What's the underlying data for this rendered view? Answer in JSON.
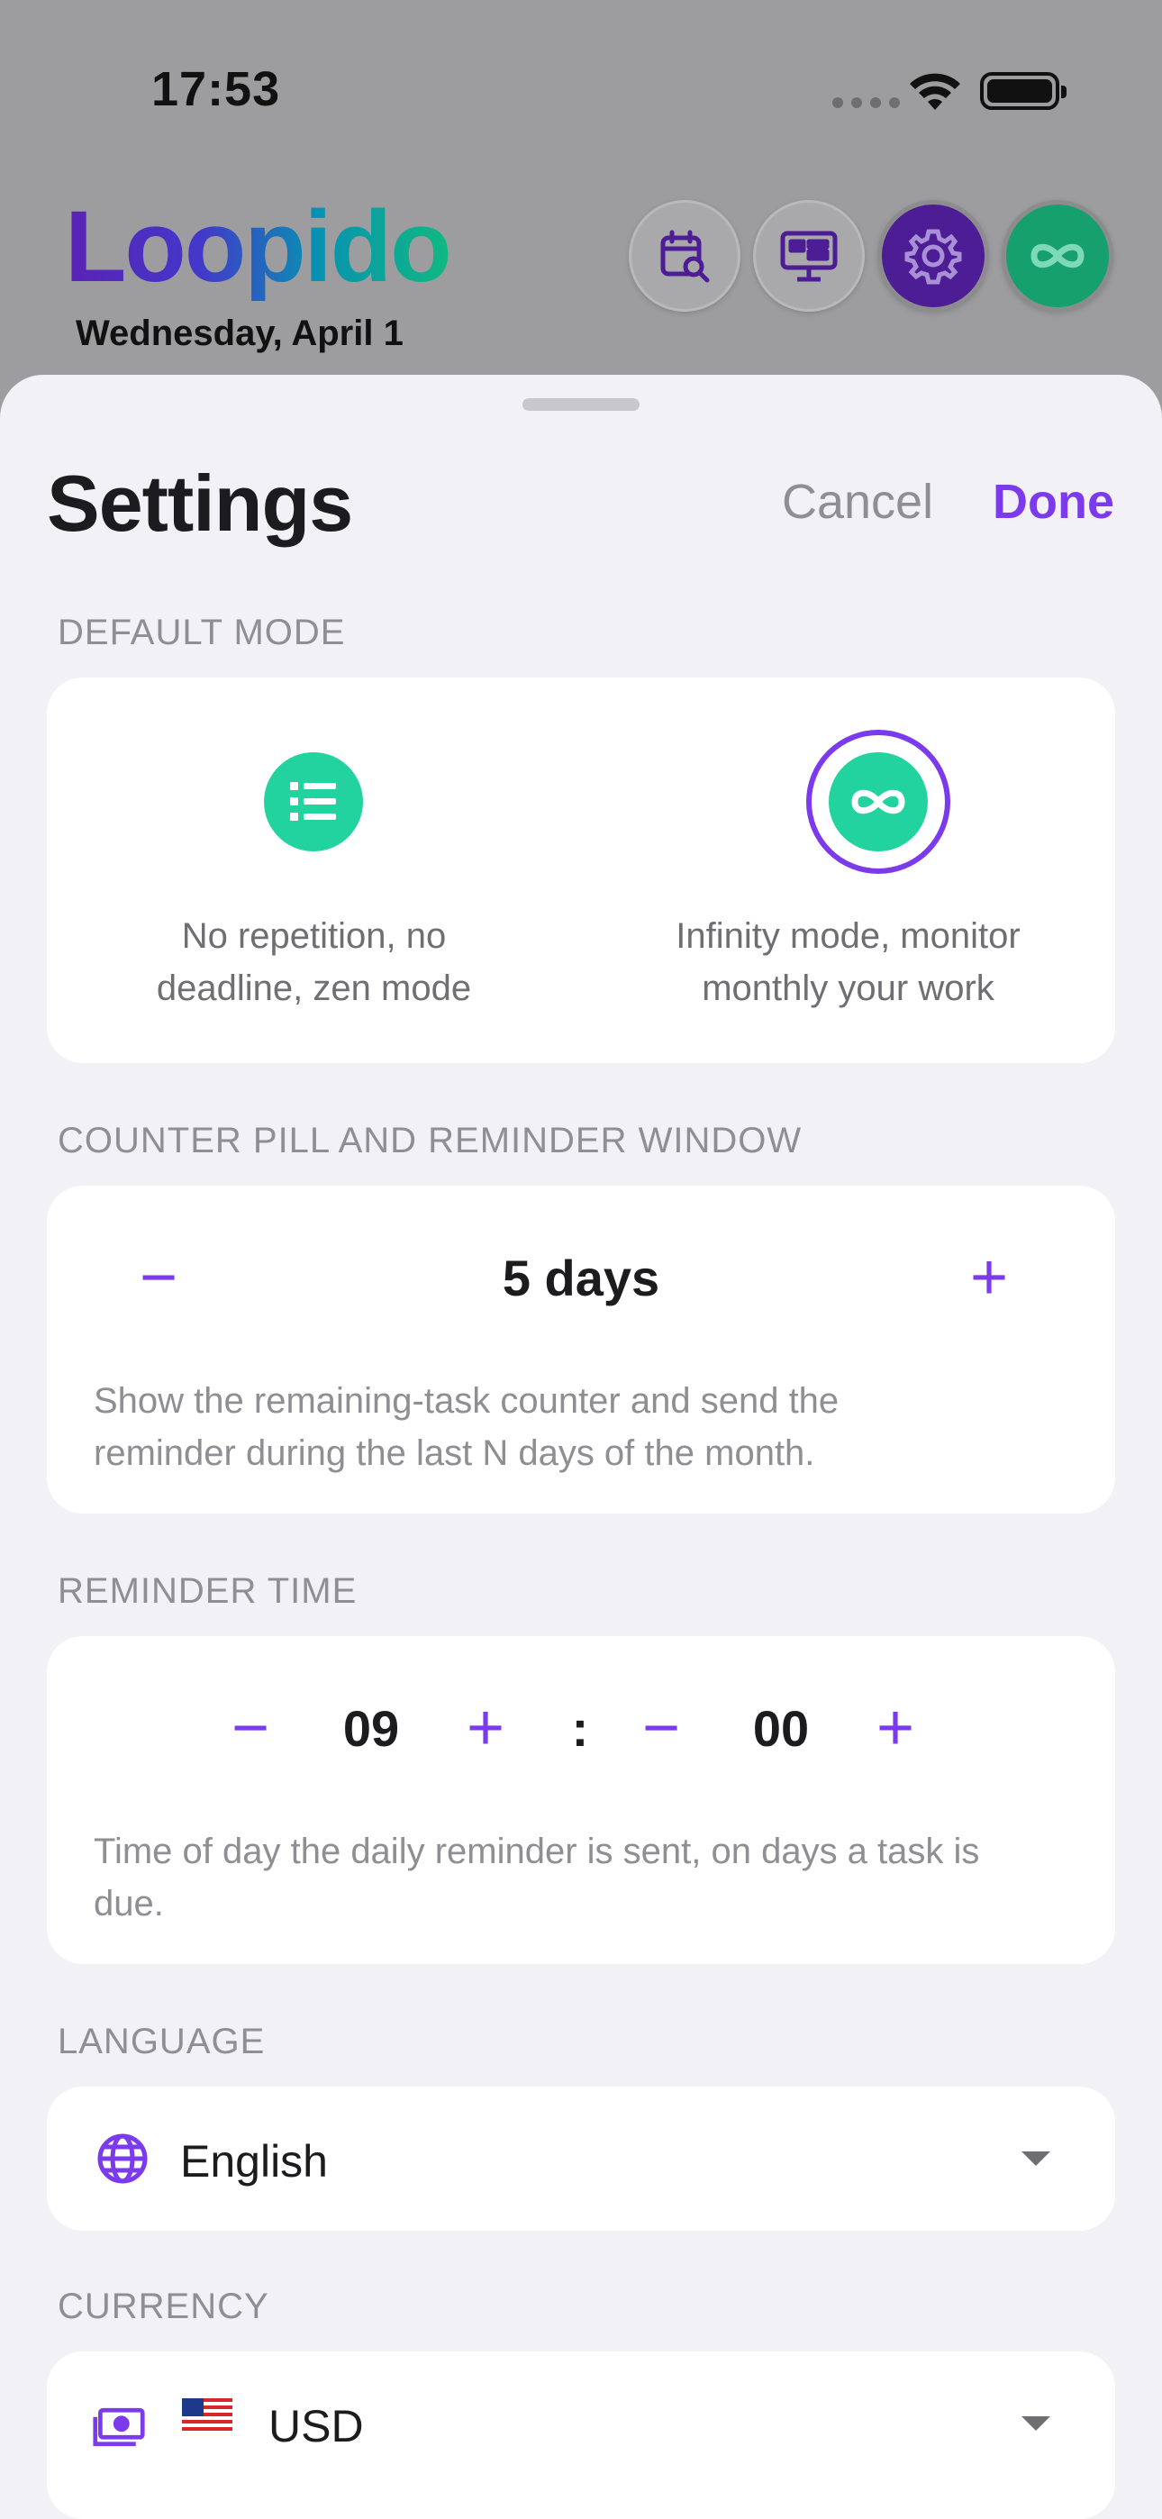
{
  "status_bar": {
    "time": "17:53"
  },
  "app": {
    "logo_text": "Loopido",
    "date": "Wednesday, April 1",
    "header_buttons": [
      "calendar-search-icon",
      "dashboard-icon",
      "gear-icon",
      "infinity-icon"
    ]
  },
  "sheet": {
    "title": "Settings",
    "cancel_label": "Cancel",
    "done_label": "Done"
  },
  "default_mode": {
    "label": "DEFAULT MODE",
    "options": [
      {
        "icon": "list-icon",
        "text_line1": "No repetition, no",
        "text_line2": "deadline, zen mode",
        "selected": false
      },
      {
        "icon": "infinity-icon",
        "text_line1": "Infinity mode, monitor",
        "text_line2": "monthly your work",
        "selected": true
      }
    ]
  },
  "counter_window": {
    "label": "COUNTER PILL AND REMINDER WINDOW",
    "minus": "−",
    "plus": "+",
    "value": "5 days",
    "description_line1": "Show the remaining-task counter and send the",
    "description_line2": "reminder during the last N days of the month."
  },
  "reminder_time": {
    "label": "REMINDER TIME",
    "hour": "09",
    "minute": "00",
    "separator": ":",
    "minus": "−",
    "plus": "+",
    "description_line1": "Time of day the daily reminder is sent, on days a task is",
    "description_line2": "due."
  },
  "language": {
    "label": "LANGUAGE",
    "value": "English",
    "icon": "globe-icon"
  },
  "currency": {
    "label": "CURRENCY",
    "value": "USD",
    "icon": "money-icon",
    "flag": "us-flag"
  },
  "colors": {
    "accent": "#7c3aed",
    "mode_green": "#22d3a0",
    "sheet_bg": "#f2f1f6",
    "secondary_text": "#8e8e93"
  }
}
